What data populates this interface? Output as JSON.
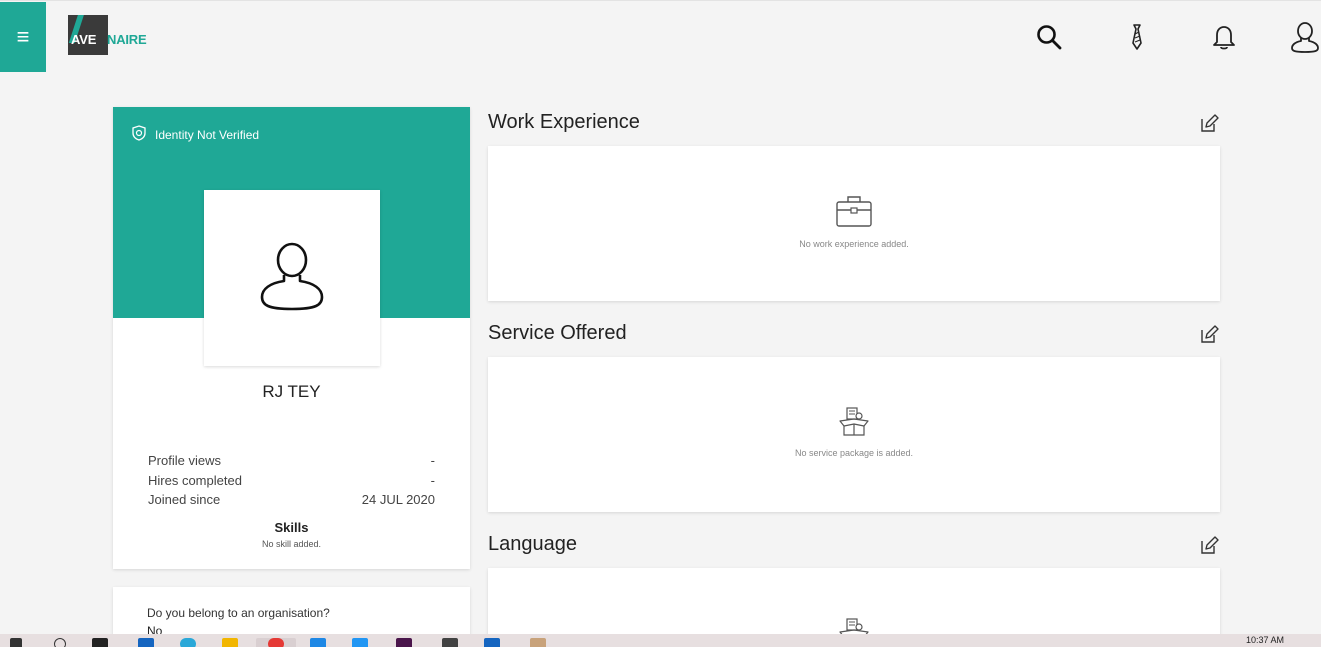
{
  "header": {
    "menu_icon": "menu-icon",
    "logo_text_a": "AVE",
    "logo_text_b": "NAIRE",
    "icons": [
      "search-icon",
      "tie-icon",
      "bell-icon",
      "user-icon"
    ]
  },
  "profile": {
    "verification": "Identity Not Verified",
    "name": "RJ TEY",
    "stats": [
      {
        "label": "Profile views",
        "value": "-"
      },
      {
        "label": "Hires completed",
        "value": "-"
      },
      {
        "label": "Joined since",
        "value": "24 JUL 2020"
      }
    ],
    "skills_title": "Skills",
    "skills_empty": "No skill added."
  },
  "organisation": {
    "question": "Do you belong to an organisation?",
    "answer": "No"
  },
  "sections": {
    "work": {
      "title": "Work Experience",
      "empty": "No work experience added."
    },
    "service": {
      "title": "Service Offered",
      "empty": "No service package is added."
    },
    "language": {
      "title": "Language"
    }
  },
  "taskbar": {
    "time": "10:37 AM"
  },
  "colors": {
    "accent": "#1fa896",
    "background": "#f4f4f4"
  }
}
